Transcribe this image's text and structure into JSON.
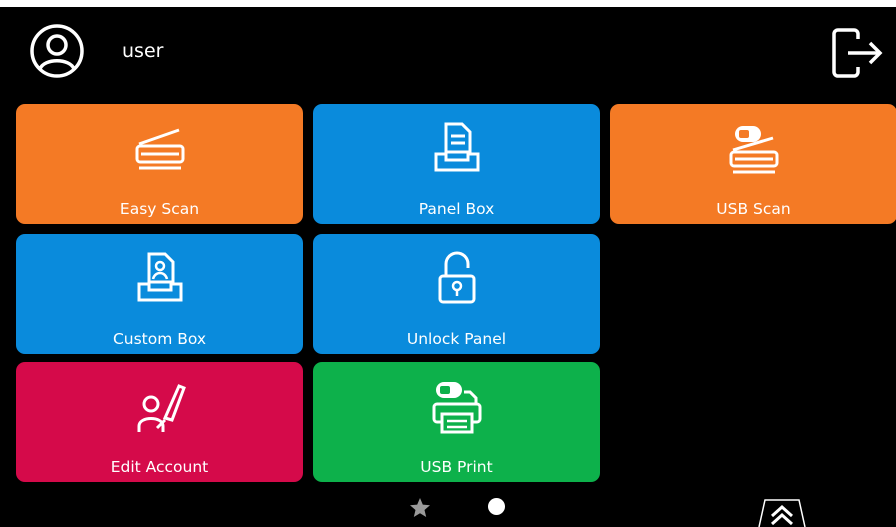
{
  "header": {
    "username": "user",
    "avatar_icon": "user-circle-icon",
    "logout_icon": "logout-icon"
  },
  "tiles": [
    {
      "label": "Easy Scan",
      "icon": "scanner-icon",
      "color": "#f47a25"
    },
    {
      "label": "Panel Box",
      "icon": "document-tray-icon",
      "color": "#0a8bdc"
    },
    {
      "label": "USB Scan",
      "icon": "usb-scanner-icon",
      "color": "#f47a25"
    },
    {
      "label": "Custom Box",
      "icon": "person-tray-icon",
      "color": "#0a8bdc"
    },
    {
      "label": "Unlock Panel",
      "icon": "unlock-icon",
      "color": "#0a8bdc"
    },
    {
      "label": "Edit Account",
      "icon": "person-pen-icon",
      "color": "#d50a4a"
    },
    {
      "label": "USB Print",
      "icon": "usb-printer-icon",
      "color": "#0db14b"
    }
  ],
  "pager": {
    "pages": [
      "favorites-star-icon",
      "page-dot-active"
    ],
    "expand_icon": "double-chevron-up-icon"
  }
}
